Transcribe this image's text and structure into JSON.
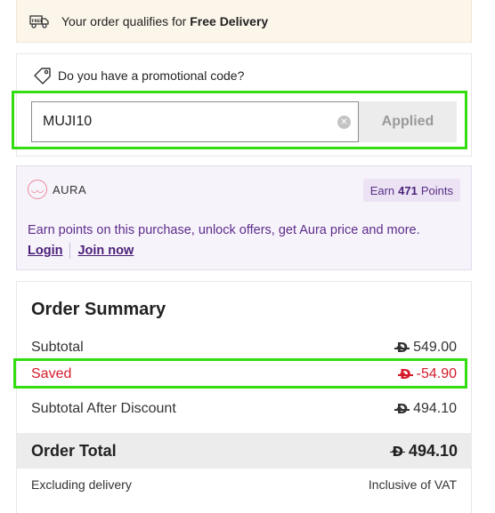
{
  "delivery": {
    "prefix": "Your order qualifies for ",
    "emphasis": "Free Delivery",
    "icon": "free-delivery-truck-icon"
  },
  "promo": {
    "question": "Do you have a promotional code?",
    "code_value": "MUJI10",
    "clear_icon": "clear-icon",
    "apply_label": "Applied"
  },
  "aura": {
    "brand": "AURA",
    "earn_prefix": "Earn",
    "earn_points": "471",
    "earn_suffix": "Points",
    "description": "Earn points on this purchase, unlock offers, get Aura price and more.",
    "login": "Login",
    "join": "Join now"
  },
  "summary": {
    "title": "Order Summary",
    "currency_symbol": "Đ",
    "subtotal_label": "Subtotal",
    "subtotal_value": "549.00",
    "saved_label": "Saved",
    "saved_value": "-54.90",
    "after_discount_label": "Subtotal After Discount",
    "after_discount_value": "494.10",
    "total_label": "Order Total",
    "total_value": "494.10",
    "delivery_note": "Excluding delivery",
    "vat_note": "Inclusive of VAT"
  },
  "colors": {
    "highlight": "#33dd11",
    "saved": "#d41b2c",
    "aura_purple": "#5c2d8a",
    "banner_bg": "#fcf6ea"
  }
}
